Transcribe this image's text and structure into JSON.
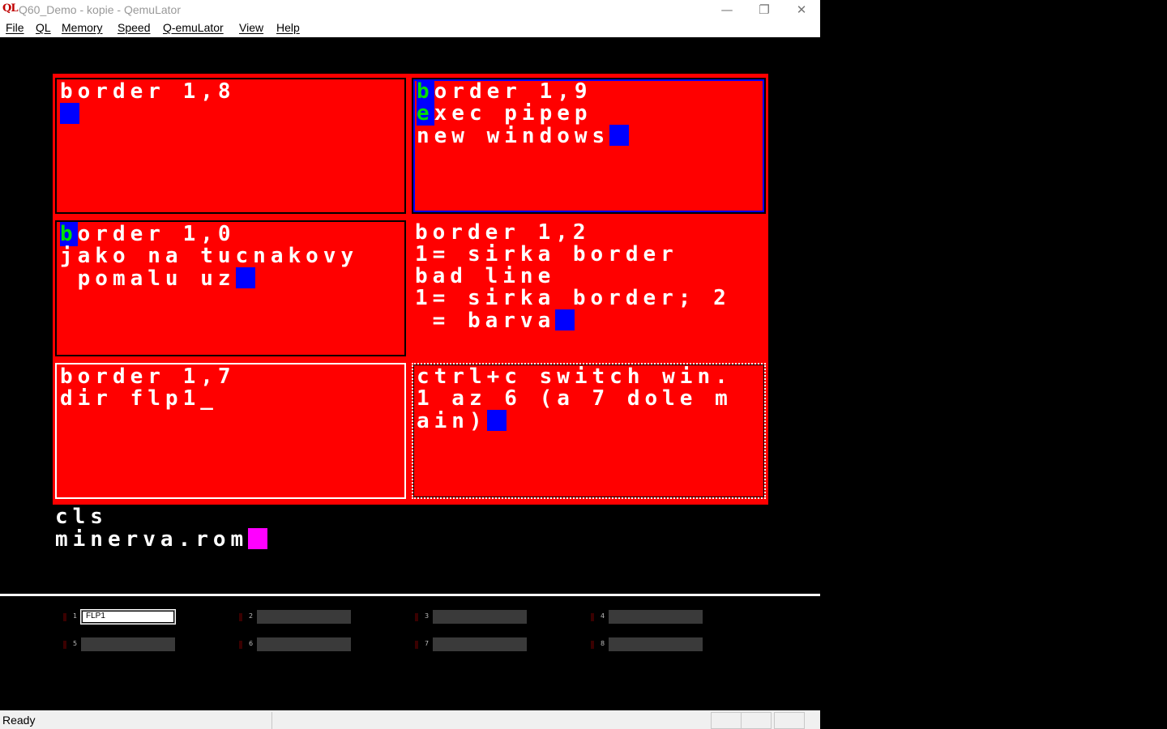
{
  "window": {
    "app_icon": "QL",
    "title": "Q60_Demo - kopie - QemuLator",
    "minimize_icon": "—",
    "restore_icon": "❐",
    "close_icon": "✕"
  },
  "menu": [
    "File",
    "QL",
    "Memory",
    "Speed",
    "Q-emuLator",
    "View",
    "Help"
  ],
  "screen": {
    "windows": [
      {
        "lines": [
          "border 1,8"
        ]
      },
      {
        "line1_first": "b",
        "line1_rest": "order 1,9",
        "line2_first": "e",
        "line2_rest": "xec pipep",
        "line3": "new windows"
      },
      {
        "line1_first": "b",
        "line1_rest": "order 1,0",
        "line2": "jako na tucnakovy",
        "line3": " pomalu uz"
      },
      {
        "lines": [
          "border 1,2",
          "1= sirka border",
          "bad line",
          "1= sirka border; 2",
          " = barva"
        ]
      },
      {
        "lines": [
          "border 1,7",
          "dir flp1_"
        ]
      },
      {
        "lines": [
          "ctrl+c switch win.",
          "1 az 6 (a 7 dole m",
          "ain)"
        ]
      }
    ],
    "main_lines": [
      "cls",
      "minerva.rom"
    ],
    "colors": {
      "paper": "#ff0000",
      "ink": "#ffffff",
      "cursor": "#0000ff",
      "main_cursor": "#ff00ff",
      "highlight_ink": "#00e000"
    }
  },
  "drives": [
    {
      "num": "1",
      "name": "FLP1"
    },
    {
      "num": "2",
      "name": ""
    },
    {
      "num": "3",
      "name": ""
    },
    {
      "num": "4",
      "name": ""
    },
    {
      "num": "5",
      "name": ""
    },
    {
      "num": "6",
      "name": ""
    },
    {
      "num": "7",
      "name": ""
    },
    {
      "num": "8",
      "name": ""
    }
  ],
  "status": {
    "text": "Ready"
  }
}
